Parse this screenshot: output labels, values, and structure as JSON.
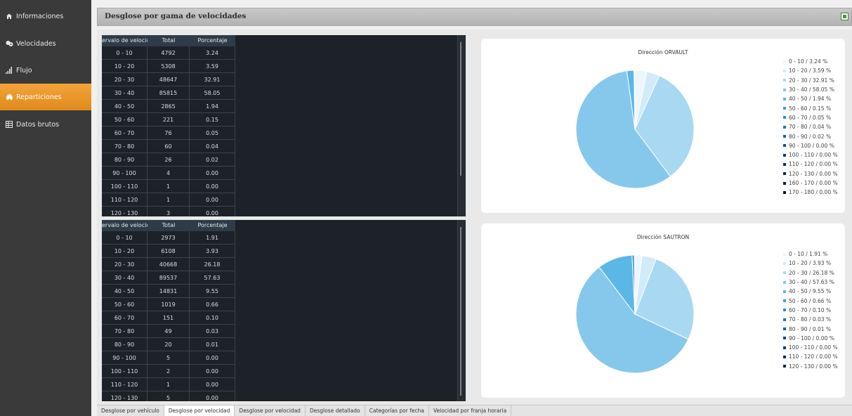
{
  "nav": [
    {
      "label": "Informaciones",
      "icon": "home-icon"
    },
    {
      "label": "Velocidades",
      "icon": "cars-icon"
    },
    {
      "label": "Flujo",
      "icon": "bar-signal-icon"
    },
    {
      "label": "Reparticiones",
      "icon": "car-icon"
    },
    {
      "label": "Datos brutos",
      "icon": "table-icon"
    }
  ],
  "header": {
    "title": "Desglose por gama de velocidades"
  },
  "table_headers": [
    "ervalo de velocid",
    "Total",
    "Porcentaje"
  ],
  "table1": [
    [
      "0 - 10",
      "4792",
      "3.24"
    ],
    [
      "10 - 20",
      "5308",
      "3.59"
    ],
    [
      "20 - 30",
      "48647",
      "32.91"
    ],
    [
      "30 - 40",
      "85815",
      "58.05"
    ],
    [
      "40 - 50",
      "2865",
      "1.94"
    ],
    [
      "50 - 60",
      "221",
      "0.15"
    ],
    [
      "60 - 70",
      "76",
      "0.05"
    ],
    [
      "70 - 80",
      "60",
      "0.04"
    ],
    [
      "80 - 90",
      "26",
      "0.02"
    ],
    [
      "90 - 100",
      "4",
      "0.00"
    ],
    [
      "100 - 110",
      "1",
      "0.00"
    ],
    [
      "110 - 120",
      "1",
      "0.00"
    ],
    [
      "120 - 130",
      "3",
      "0.00"
    ]
  ],
  "table2": [
    [
      "0 - 10",
      "2973",
      "1.91"
    ],
    [
      "10 - 20",
      "6108",
      "3.93"
    ],
    [
      "20 - 30",
      "40668",
      "26.18"
    ],
    [
      "30 - 40",
      "89537",
      "57.63"
    ],
    [
      "40 - 50",
      "14831",
      "9.55"
    ],
    [
      "50 - 60",
      "1019",
      "0.66"
    ],
    [
      "60 - 70",
      "151",
      "0.10"
    ],
    [
      "70 - 80",
      "49",
      "0.03"
    ],
    [
      "80 - 90",
      "20",
      "0.01"
    ],
    [
      "90 - 100",
      "5",
      "0.00"
    ],
    [
      "100 - 110",
      "2",
      "0.00"
    ],
    [
      "110 - 120",
      "1",
      "0.00"
    ],
    [
      "120 - 130",
      "5",
      "0.00"
    ]
  ],
  "colors": [
    "#ecf6fc",
    "#d2ebf8",
    "#a9d8f2",
    "#86c8ec",
    "#5ab7e6",
    "#3aa0d8",
    "#2d8cc4",
    "#2278b0",
    "#18649a",
    "#114e82",
    "#0e3f6b",
    "#0b3358",
    "#092946",
    "#071f36",
    "#051628"
  ],
  "chart_data": [
    {
      "type": "pie",
      "title": "Dirección ORVAULT",
      "legend": [
        "0 - 10 / 3.24 %",
        "10 - 20 / 3.59 %",
        "20 - 30 / 32.91 %",
        "30 - 40 / 58.05 %",
        "40 - 50 / 1.94 %",
        "50 - 60 / 0.15 %",
        "60 - 70 / 0.05 %",
        "70 - 80 / 0.04 %",
        "80 - 90 / 0.02 %",
        "90 - 100 / 0.00 %",
        "100 - 110 / 0.00 %",
        "110 - 120 / 0.00 %",
        "120 - 130 / 0.00 %",
        "160 - 170 / 0.00 %",
        "170 - 180 / 0.00 %"
      ],
      "values": [
        3.24,
        3.59,
        32.91,
        58.05,
        1.94,
        0.15,
        0.05,
        0.04,
        0.02,
        0,
        0,
        0,
        0,
        0,
        0
      ],
      "legend_position": "right"
    },
    {
      "type": "pie",
      "title": "Dirección SAUTRON",
      "legend": [
        "0 - 10 / 1.91 %",
        "10 - 20 / 3.93 %",
        "20 - 30 / 26.18 %",
        "30 - 40 / 57.63 %",
        "40 - 50 / 9.55 %",
        "50 - 60 / 0.66 %",
        "60 - 70 / 0.10 %",
        "70 - 80 / 0.03 %",
        "80 - 90 / 0.01 %",
        "90 - 100 / 0.00 %",
        "100 - 110 / 0.00 %",
        "110 - 120 / 0.00 %",
        "120 - 130 / 0.00 %"
      ],
      "values": [
        1.91,
        3.93,
        26.18,
        57.63,
        9.55,
        0.66,
        0.1,
        0.03,
        0.01,
        0,
        0,
        0,
        0
      ],
      "legend_position": "right"
    }
  ],
  "tabs": [
    "Desglose por vehículo",
    "Desglose por velocidad",
    "Desglose por velocidad",
    "Desglose detallado",
    "Categorías por fecha",
    "Velocidad por franja horaria"
  ]
}
